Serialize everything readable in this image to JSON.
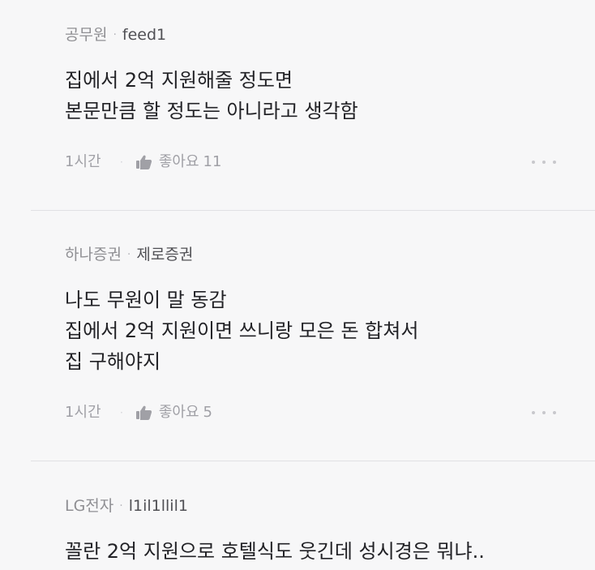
{
  "comments": [
    {
      "company": "공무원",
      "nickname": "feed1",
      "lines": [
        "집에서 2억 지원해줄 정도면",
        "본문만큼 할 정도는 아니라고 생각함"
      ],
      "time": "1시간",
      "like_label": "좋아요",
      "likes": "11"
    },
    {
      "company": "하나증권",
      "nickname": "제로증권",
      "lines": [
        "나도 무원이 말 동감",
        "집에서 2억 지원이면 쓰니랑 모은 돈 합쳐서",
        "집 구해야지"
      ],
      "time": "1시간",
      "like_label": "좋아요",
      "likes": "5"
    },
    {
      "company": "LG전자",
      "nickname": "l1il1llil1",
      "lines": [
        "꼴란 2억 지원으로 호텔식도 웃긴데 성시경은 뭐냐.."
      ]
    }
  ],
  "icons": {
    "like": "thumbs-up-icon",
    "more": "more-options-icon"
  },
  "colors": {
    "background": "#f7f7f8",
    "body_text": "#222226",
    "secondary_text": "#8f8f93",
    "meta_text": "#a0a0a6"
  }
}
